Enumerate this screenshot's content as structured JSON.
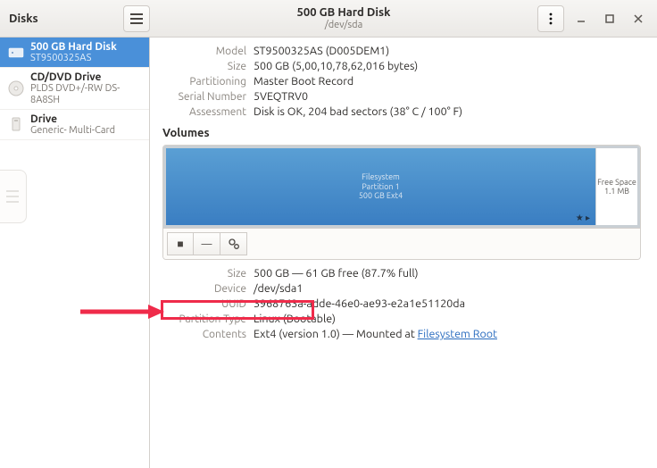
{
  "header": {
    "appTitle": "Disks",
    "windowTitle": "500 GB Hard Disk",
    "windowSubtitle": "/dev/sda"
  },
  "sidebar": {
    "items": [
      {
        "name": "500 GB Hard Disk",
        "sub": "ST9500325AS",
        "icon": "hdd"
      },
      {
        "name": "CD/DVD Drive",
        "sub": "PLDS DVD+/-RW DS-8A8SH",
        "icon": "optical"
      },
      {
        "name": "Drive",
        "sub": "Generic- Multi-Card",
        "icon": "card"
      }
    ]
  },
  "disk": {
    "model": {
      "label": "Model",
      "value": "ST9500325AS (D005DEM1)"
    },
    "size": {
      "label": "Size",
      "value": "500 GB (5,00,10,78,62,016 bytes)"
    },
    "partitioning": {
      "label": "Partitioning",
      "value": "Master Boot Record"
    },
    "serial": {
      "label": "Serial Number",
      "value": "5VEQTRV0"
    },
    "assessment": {
      "label": "Assessment",
      "value": "Disk is OK, 204 bad sectors (38° C / 100° F)"
    }
  },
  "volumesTitle": "Volumes",
  "volume": {
    "partLabel1": "Filesystem",
    "partLabel2": "Partition 1",
    "partLabel3": "500 GB Ext4",
    "freeLabel": "Free Space",
    "freeSize": "1.1 MB"
  },
  "partition": {
    "size": {
      "label": "Size",
      "value": "500 GB — 61 GB free (87.7% full)"
    },
    "device": {
      "label": "Device",
      "value": "/dev/sda1"
    },
    "uuid": {
      "label": "UUID",
      "value": "3968763a-adde-46e0-ae93-e2a1e51120da"
    },
    "ptype": {
      "label": "Partition Type",
      "value": "Linux (Bootable)"
    },
    "contents": {
      "label": "Contents",
      "prefix": "Ext4 (version 1.0) — Mounted at ",
      "link": "Filesystem Root"
    }
  }
}
